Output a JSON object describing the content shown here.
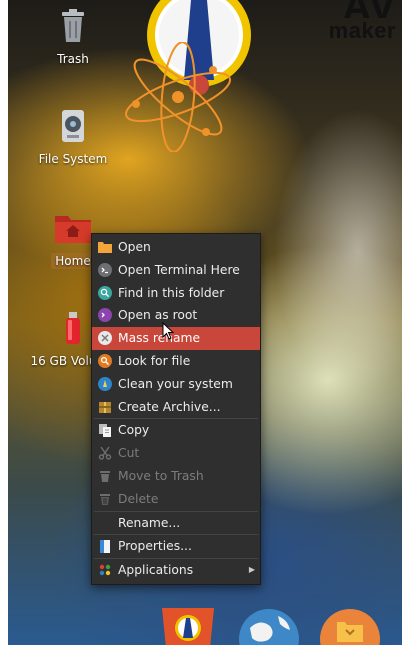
{
  "brand": {
    "line1": "AV",
    "line2": "maker"
  },
  "desktop_icons": [
    {
      "label": "Trash"
    },
    {
      "label": "File System"
    },
    {
      "label": "Home"
    },
    {
      "label": "16 GB Volume"
    }
  ],
  "context_menu": {
    "items": [
      {
        "label": "Open",
        "icon": "folder-icon"
      },
      {
        "label": "Open Terminal Here",
        "icon": "terminal-icon"
      },
      {
        "label": "Find in this folder",
        "icon": "search-icon"
      },
      {
        "label": "Open as root",
        "icon": "root-icon"
      },
      {
        "label": "Mass rename",
        "icon": "rename-icon",
        "highlighted": true
      },
      {
        "label": "Look for file",
        "icon": "lookup-icon"
      },
      {
        "label": "Clean your system",
        "icon": "cleaner-icon"
      },
      {
        "label": "Create Archive...",
        "icon": "archive-icon"
      },
      {
        "label": "Copy",
        "icon": "copy-icon"
      },
      {
        "label": "Cut",
        "icon": "cut-icon",
        "disabled": true
      },
      {
        "label": "Move to Trash",
        "icon": "trash-icon",
        "disabled": true
      },
      {
        "label": "Delete",
        "icon": "delete-icon",
        "disabled": true
      },
      {
        "label": "Rename...",
        "icon": ""
      },
      {
        "label": "Properties...",
        "icon": "properties-icon"
      },
      {
        "label": "Applications",
        "icon": "applications-icon",
        "submenu": true
      }
    ]
  },
  "colors": {
    "highlight": "#c9463a",
    "menu_bg": "#2f2f2f",
    "folder": "#d63a2a"
  }
}
